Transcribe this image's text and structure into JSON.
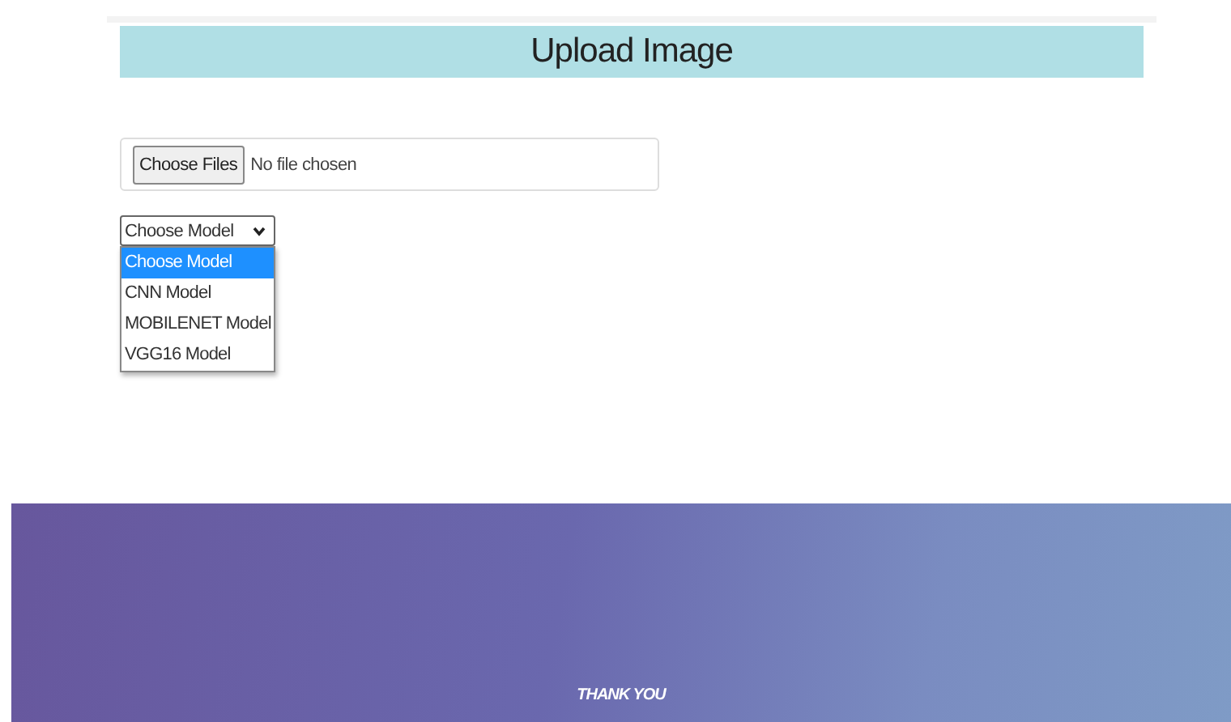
{
  "header": {
    "title": "Upload Image"
  },
  "file_input": {
    "button": "Choose Files",
    "status": "No file chosen"
  },
  "model_select": {
    "value": "Choose Model",
    "expanded": true,
    "options": [
      {
        "label": "Choose Model",
        "selected": true
      },
      {
        "label": "CNN Model",
        "selected": false
      },
      {
        "label": "MOBILENET Model",
        "selected": false
      },
      {
        "label": "VGG16 Model",
        "selected": false
      }
    ]
  },
  "footer": {
    "text": "THANK YOU"
  }
}
